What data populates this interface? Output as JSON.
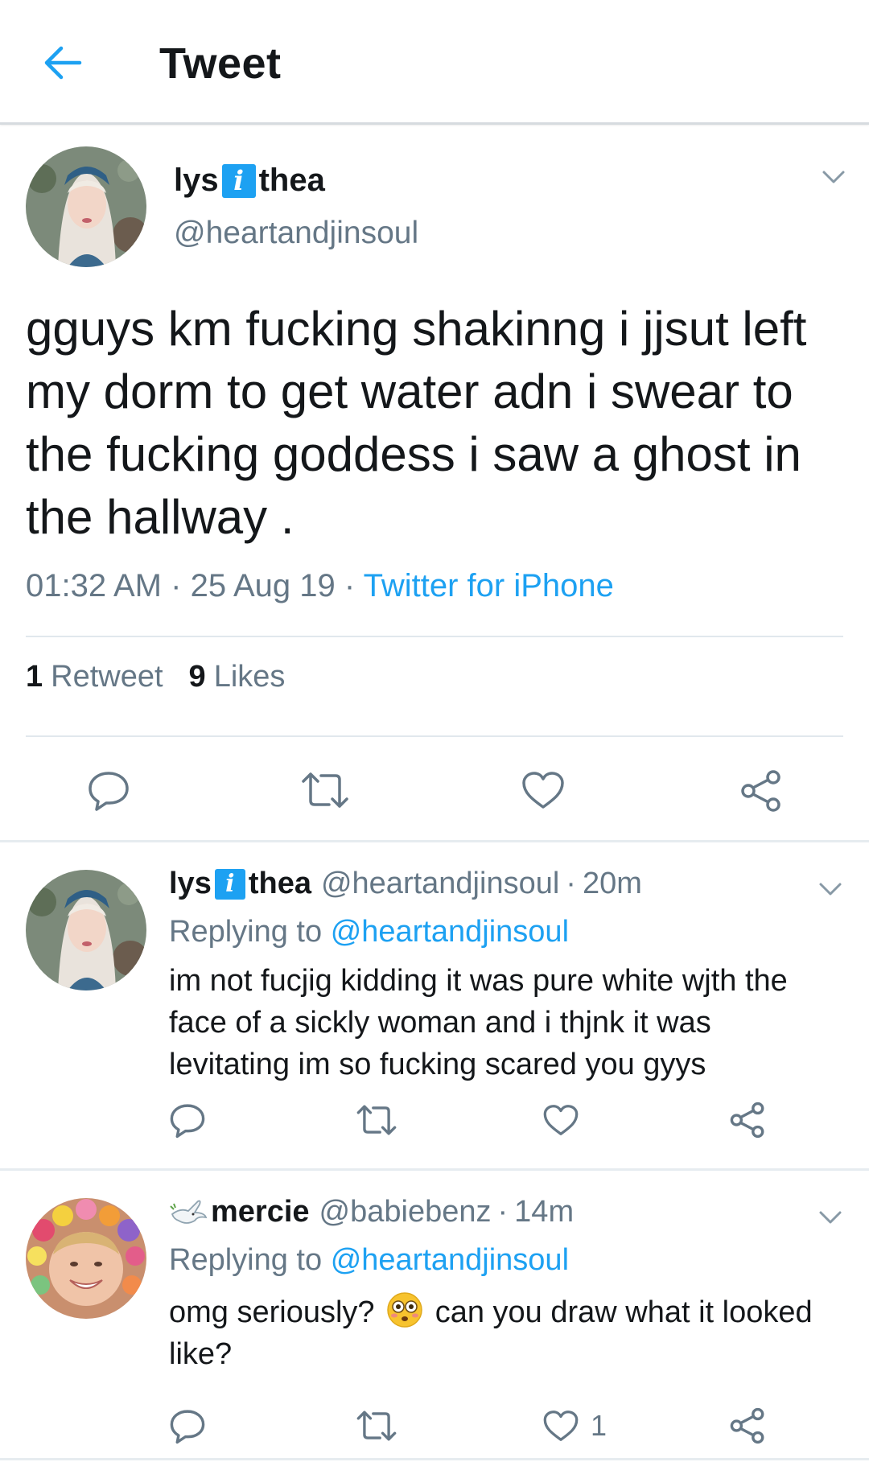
{
  "header": {
    "title": "Tweet",
    "back_icon": "arrow-left-icon",
    "accent_color": "#1da1f2"
  },
  "main_tweet": {
    "name_prefix": "lys",
    "name_badge": "i",
    "name_suffix": "thea",
    "handle": "@heartandjinsoul",
    "text": "gguys km fucking shakinng i jjsut left my dorm to get water adn i swear to the fucking goddess i saw a ghost in the hallway .",
    "time": "01:32 AM",
    "date": "25 Aug 19",
    "source": "Twitter for iPhone",
    "sep": "·",
    "retweet_count": "1",
    "retweet_label": "Retweet",
    "like_count": "9",
    "like_label": "Likes"
  },
  "replies": [
    {
      "name_prefix": "lys",
      "name_badge": "i",
      "name_suffix": "thea",
      "handle": "@heartandjinsoul",
      "sep": "·",
      "time": "20m",
      "replying_label": "Replying to",
      "replying_to": "@heartandjinsoul",
      "text": "im not fucjig kidding it was pure white wjth the face of a sickly woman and i thjnk it was levitating im so fucking scared you gyys"
    },
    {
      "name": "mercie",
      "handle": "@babiebenz",
      "sep": "·",
      "time": "14m",
      "replying_label": "Replying to",
      "replying_to": "@heartandjinsoul",
      "text_before": "omg seriously?",
      "text_after": "can you draw what it looked like?",
      "emoji": "flushed-face-icon",
      "like_count": "1"
    }
  ],
  "colors": {
    "text": "#14171a",
    "secondary": "#657786",
    "link": "#1da1f2",
    "divider": "#e1e8ed"
  }
}
